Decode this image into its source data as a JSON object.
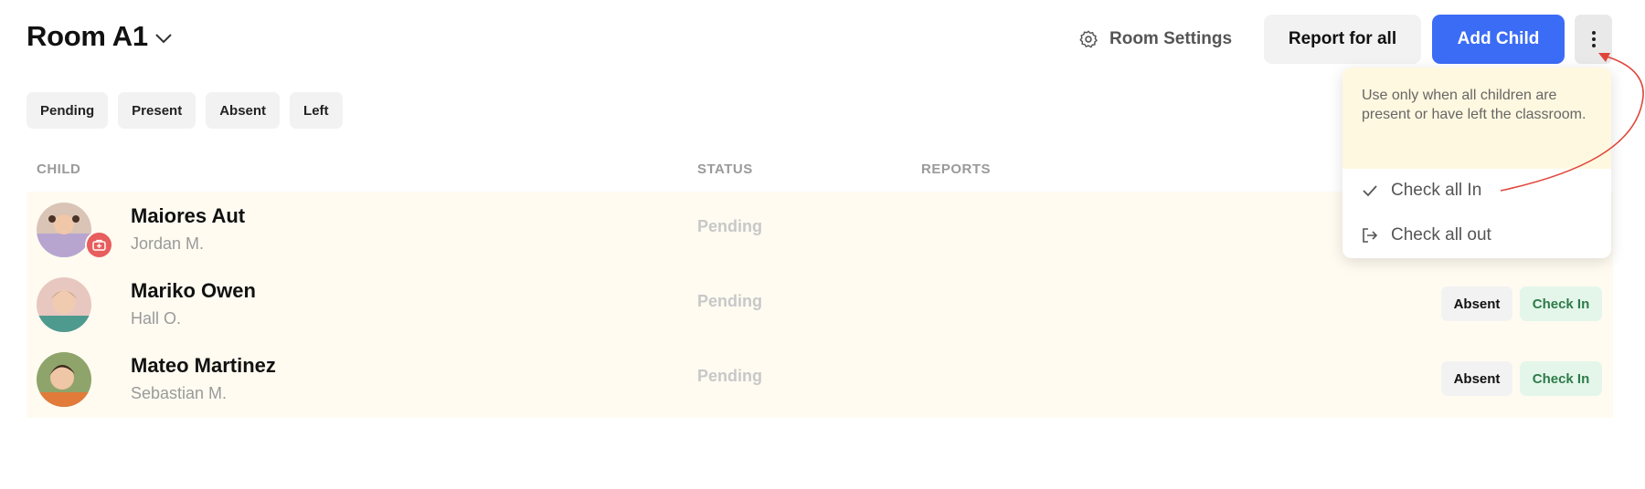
{
  "header": {
    "room_title": "Room A1",
    "settings_label": "Room Settings",
    "report_label": "Report for all",
    "add_child_label": "Add Child"
  },
  "filters": [
    "Pending",
    "Present",
    "Absent",
    "Left"
  ],
  "columns": {
    "child": "CHILD",
    "status": "STATUS",
    "reports": "REPORTS"
  },
  "children": [
    {
      "name": "Maiores Aut",
      "guardian": "Jordan M.",
      "status": "Pending",
      "medical_badge": true
    },
    {
      "name": "Mariko Owen",
      "guardian": "Hall O.",
      "status": "Pending",
      "medical_badge": false
    },
    {
      "name": "Mateo Martinez",
      "guardian": "Sebastian M.",
      "status": "Pending",
      "medical_badge": false
    }
  ],
  "row_actions": {
    "absent": "Absent",
    "check_in": "Check In"
  },
  "dropdown": {
    "note": "Use only when all children are present or have left the classroom.",
    "check_all_in": "Check all In",
    "check_all_out": "Check all out"
  },
  "colors": {
    "accent": "#3b6cf6",
    "row_bg": "#fffbf1",
    "note_bg": "#fff8e0",
    "checkin_bg": "#e4f6ea",
    "annotation": "#e0453a"
  },
  "icons": [
    "chevron-down-icon",
    "gear-icon",
    "kebab-icon",
    "medical-kit-icon",
    "checkmark-icon",
    "exit-icon"
  ]
}
